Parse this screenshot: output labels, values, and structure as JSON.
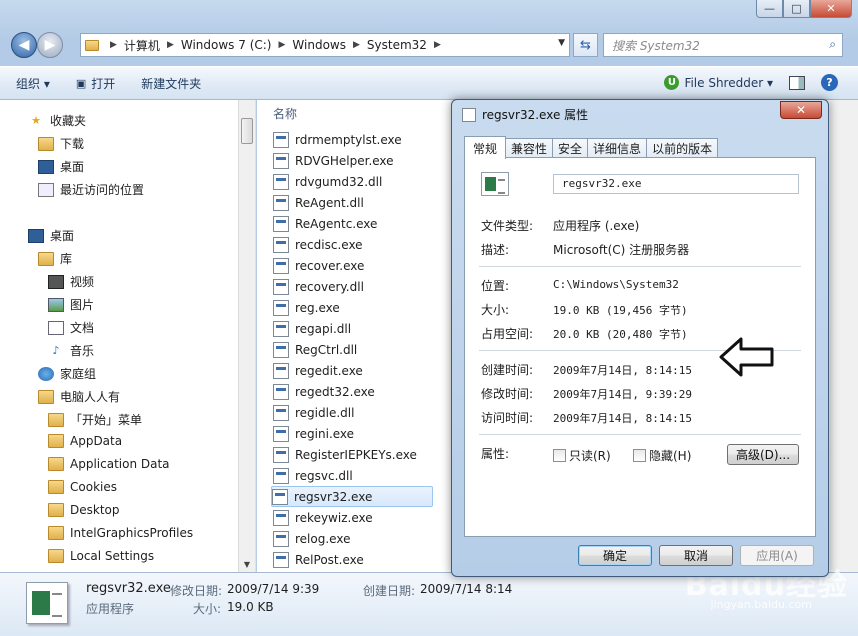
{
  "window": {
    "minimize": "—",
    "maximize": "□",
    "close": "✕"
  },
  "address": {
    "crumbs": [
      "计算机",
      "Windows 7 (C:)",
      "Windows",
      "System32"
    ]
  },
  "search": {
    "placeholder": "搜索 System32"
  },
  "toolbar": {
    "organize": "组织 ▾",
    "open": "打开",
    "new_folder": "新建文件夹",
    "file_shredder": "File Shredder ▾",
    "help": "?"
  },
  "sidebar": {
    "favorites": "收藏夹",
    "downloads": "下载",
    "desktop_fav": "桌面",
    "recent": "最近访问的位置",
    "desktop": "桌面",
    "libraries": "库",
    "videos": "视频",
    "pictures": "图片",
    "documents": "文档",
    "music": "音乐",
    "homegroup": "家庭组",
    "user": "电脑人人有",
    "folders": [
      "「开始」菜单",
      "AppData",
      "Application Data",
      "Cookies",
      "Desktop",
      "IntelGraphicsProfiles",
      "Local Settings"
    ]
  },
  "filelist": {
    "column_name": "名称",
    "files": [
      "rdrmemptylst.exe",
      "RDVGHelper.exe",
      "rdvgumd32.dll",
      "ReAgent.dll",
      "ReAgentc.exe",
      "recdisc.exe",
      "recover.exe",
      "recovery.dll",
      "reg.exe",
      "regapi.dll",
      "RegCtrl.dll",
      "regedit.exe",
      "regedt32.exe",
      "regidle.dll",
      "regini.exe",
      "RegisterIEPKEYs.exe",
      "regsvc.dll",
      "regsvr32.exe",
      "rekeywiz.exe",
      "relog.exe",
      "RelPost.exe"
    ]
  },
  "details": {
    "name": "regsvr32.exe",
    "modified_label": "修改日期:",
    "modified": "2009/7/14 9:39",
    "created_label": "创建日期:",
    "created": "2009/7/14 8:14",
    "type": "应用程序",
    "size_label": "大小:",
    "size": "19.0 KB"
  },
  "dialog": {
    "title": "regsvr32.exe 属性",
    "close": "✕",
    "tabs": [
      "常规",
      "兼容性",
      "安全",
      "详细信息",
      "以前的版本"
    ],
    "filename": "regsvr32.exe",
    "type_label": "文件类型:",
    "type_value": "应用程序 (.exe)",
    "desc_label": "描述:",
    "desc_value": "Microsoft(C) 注册服务器",
    "location_label": "位置:",
    "location_value": "C:\\Windows\\System32",
    "size_label": "大小:",
    "size_value": "19.0 KB (19,456 字节)",
    "disk_label": "占用空间:",
    "disk_value": "20.0 KB (20,480 字节)",
    "created_label": "创建时间:",
    "created_value": "2009年7月14日, 8:14:15",
    "modified_label": "修改时间:",
    "modified_value": "2009年7月14日, 9:39:29",
    "accessed_label": "访问时间:",
    "accessed_value": "2009年7月14日, 8:14:15",
    "attr_label": "属性:",
    "readonly": "只读(R)",
    "hidden": "隐藏(H)",
    "advanced": "高级(D)...",
    "ok": "确定",
    "cancel": "取消",
    "apply": "应用(A)"
  },
  "watermark": {
    "brand": "Baidu经验",
    "url": "jingyan.baidu.com"
  }
}
